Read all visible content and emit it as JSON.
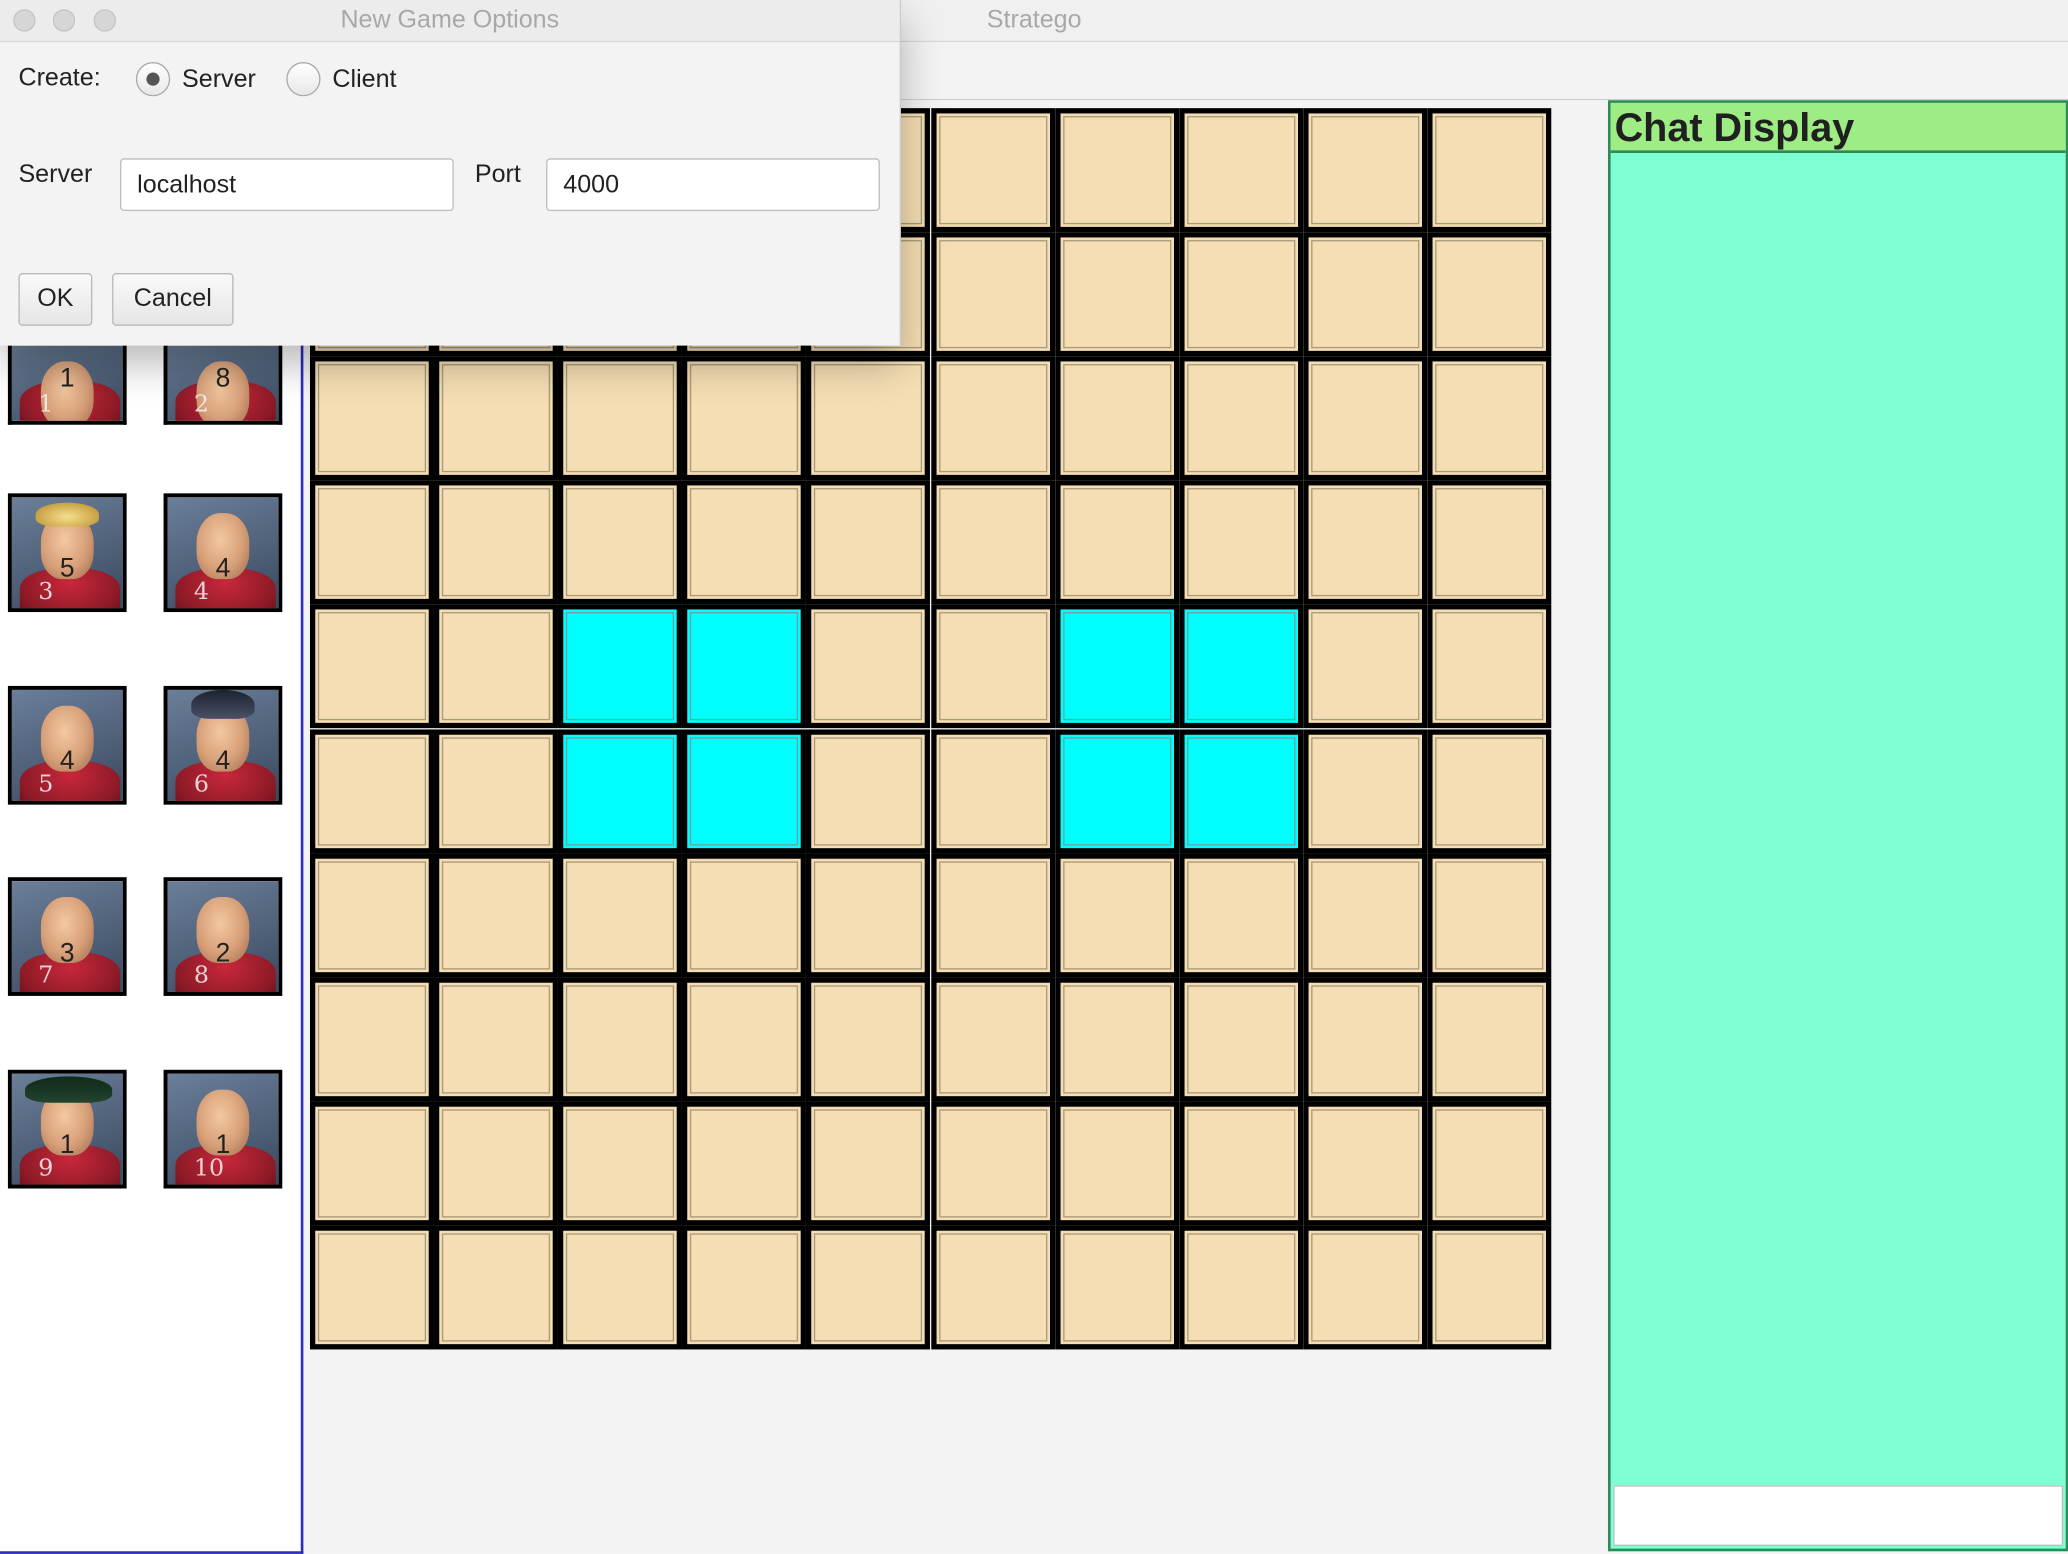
{
  "main_window": {
    "title": "Stratego"
  },
  "dialog": {
    "title": "New Game Options",
    "create_label": "Create:",
    "options": [
      {
        "label": "Server",
        "selected": true
      },
      {
        "label": "Client",
        "selected": false
      }
    ],
    "server_label": "Server",
    "server_value": "localhost",
    "port_label": "Port",
    "port_value": "4000",
    "ok_label": "OK",
    "cancel_label": "Cancel"
  },
  "pieces": [
    {
      "rank": "1",
      "count": "1",
      "hat": "none"
    },
    {
      "rank": "2",
      "count": "8",
      "hat": "none"
    },
    {
      "rank": "3",
      "count": "5",
      "hat": "gold"
    },
    {
      "rank": "4",
      "count": "4",
      "hat": "none"
    },
    {
      "rank": "5",
      "count": "4",
      "hat": "none"
    },
    {
      "rank": "6",
      "count": "4",
      "hat": "shako"
    },
    {
      "rank": "7",
      "count": "3",
      "hat": "none"
    },
    {
      "rank": "8",
      "count": "2",
      "hat": "none"
    },
    {
      "rank": "9",
      "count": "1",
      "hat": "bicorne"
    },
    {
      "rank": "10",
      "count": "1",
      "hat": "none"
    }
  ],
  "board": {
    "rows": 10,
    "cols": 10,
    "water_cells": [
      [
        4,
        2
      ],
      [
        4,
        3
      ],
      [
        5,
        2
      ],
      [
        5,
        3
      ],
      [
        4,
        6
      ],
      [
        4,
        7
      ],
      [
        5,
        6
      ],
      [
        5,
        7
      ]
    ],
    "colors": {
      "land": "#f5deb3",
      "water": "#00ffff",
      "grid": "#000000"
    }
  },
  "chat": {
    "title": "Chat Display",
    "colors": {
      "header": "#9ded84",
      "body": "#7fffd4",
      "border": "#2e8b57"
    },
    "input_value": ""
  }
}
